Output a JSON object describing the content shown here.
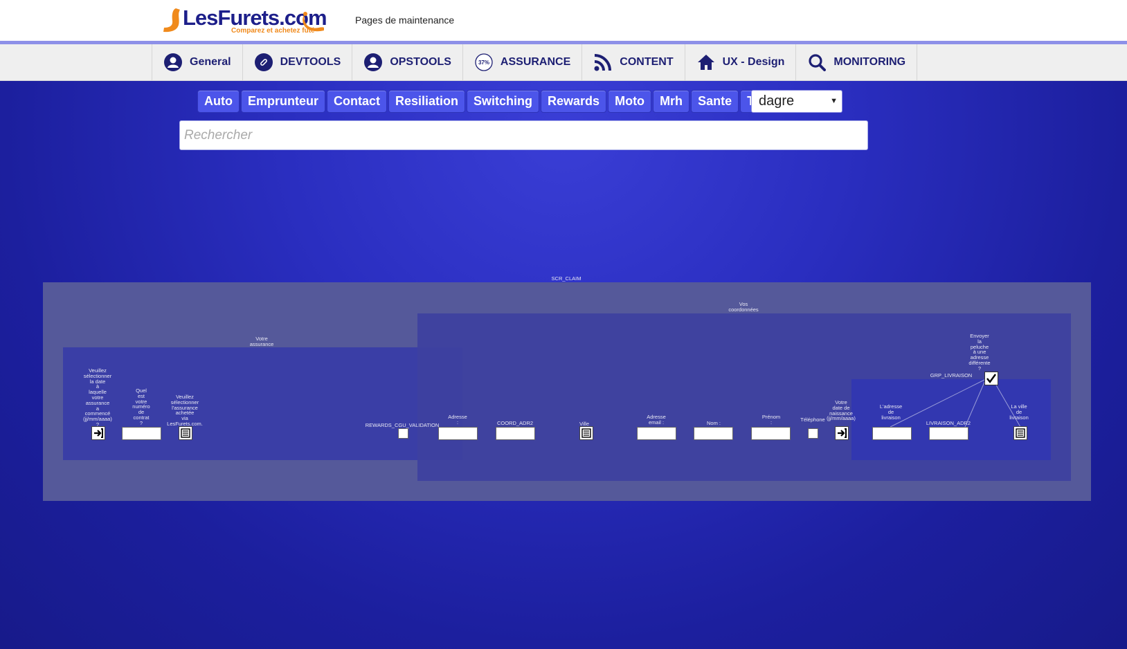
{
  "header": {
    "logo_text": "LesFurets.com",
    "logo_tagline": "Comparez et achetez futé",
    "page_subtitle": "Pages de maintenance"
  },
  "nav": {
    "items": [
      {
        "label": "General",
        "icon": "user-icon"
      },
      {
        "label": "DEVTOOLS",
        "icon": "link-icon"
      },
      {
        "label": "OPSTOOLS",
        "icon": "user-icon"
      },
      {
        "label": "ASSURANCE",
        "icon": "percent-badge-icon",
        "badge": "37%"
      },
      {
        "label": "CONTENT",
        "icon": "rss-icon"
      },
      {
        "label": "UX - Design",
        "icon": "home-icon"
      },
      {
        "label": "MONITORING",
        "icon": "search-icon"
      }
    ]
  },
  "filters": [
    "Auto",
    "Emprunteur",
    "Contact",
    "Resiliation",
    "Switching",
    "Rewards",
    "Moto",
    "Mrh",
    "Sante",
    "Telco"
  ],
  "select": {
    "value": "dagre"
  },
  "search": {
    "placeholder": "Rechercher"
  },
  "graph": {
    "root_label": "SCR_CLAIM",
    "group_coordonnees": "Vos\ncoordonnées",
    "group_assurance": "Votre\nassurance",
    "group_livraison": "GRP_LIVRAISON",
    "fields": {
      "date_assurance": "Veuillez\nsélectionner\nla date\nà\nlaquelle\nvotre\nassurance\na\ncommencé\n(jj/mm/aaaa)\n?",
      "numero_contrat": "Quel\nest\nvotre\nnuméro\nde\ncontrat\n?",
      "assurance_achetee": "Veuillez\nsélectionner\nl'assurance\nachetée\nvia\nLesFurets.com.",
      "rewards_cgu": "REWARDS_CGU_VALIDATION",
      "adresse": "Adresse\n:",
      "coord_adr2": "COORD_ADR2",
      "ville": "Ville\n:",
      "email": "Adresse\nemail :",
      "nom": "Nom :",
      "prenom": "Prénom\n:",
      "telephone": "Téléphone",
      "naissance": "Votre\ndate de\nnaissance\n(jj/mm/aaaa)",
      "adresse_livraison": "L'adresse\nde\nlivraison",
      "livraison_adr2": "LIVRAISON_ADR2",
      "ville_livraison": "La ville\nde\nlivraison",
      "peluche": "Envoyer\nla\npeluche\nà une\nadresse\ndifférente\n?"
    }
  },
  "colors": {
    "brand_navy": "#1d1f73",
    "brand_orange": "#f08a1c",
    "accent_blue": "#4c55ea"
  }
}
